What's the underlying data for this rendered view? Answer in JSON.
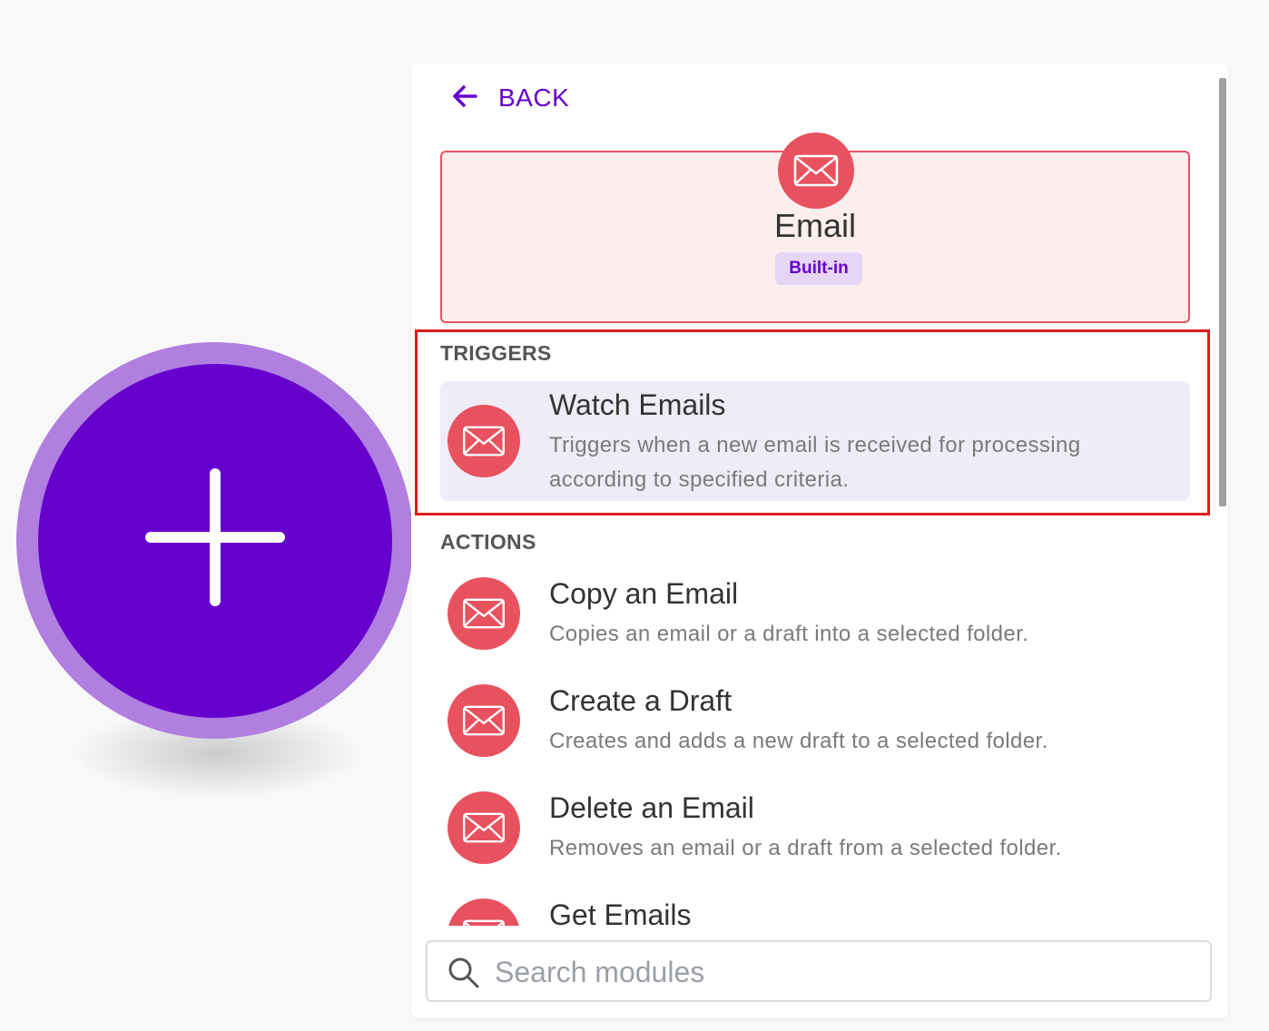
{
  "canvas": {
    "add_module_node": {
      "icon": "plus-icon",
      "color": "#6600cc",
      "ring_color": "#b07fe0"
    }
  },
  "panel": {
    "back": {
      "label": "BACK",
      "icon": "arrow-left-icon"
    },
    "app": {
      "name": "Email",
      "badge": "Built-in",
      "icon": "envelope-icon",
      "brand_color": "#e8525f"
    },
    "sections": {
      "triggers": {
        "label": "TRIGGERS",
        "modules": [
          {
            "title": "Watch Emails",
            "description": "Triggers when a new email is received for processing according to specified criteria.",
            "icon": "envelope-icon",
            "highlighted": true
          }
        ]
      },
      "actions": {
        "label": "ACTIONS",
        "modules": [
          {
            "title": "Copy an Email",
            "description": "Copies an email or a draft into a selected folder.",
            "icon": "envelope-icon"
          },
          {
            "title": "Create a Draft",
            "description": "Creates and adds a new draft to a selected folder.",
            "icon": "envelope-icon"
          },
          {
            "title": "Delete an Email",
            "description": "Removes an email or a draft from a selected folder.",
            "icon": "envelope-icon"
          },
          {
            "title": "Get Emails",
            "icon": "envelope-icon"
          }
        ]
      }
    },
    "search": {
      "placeholder": "Search modules",
      "value": "",
      "icon": "search-icon"
    }
  },
  "colors": {
    "accent": "#6600cc",
    "highlight_outline": "#e01b1b",
    "selected_row": "#efebf7"
  }
}
